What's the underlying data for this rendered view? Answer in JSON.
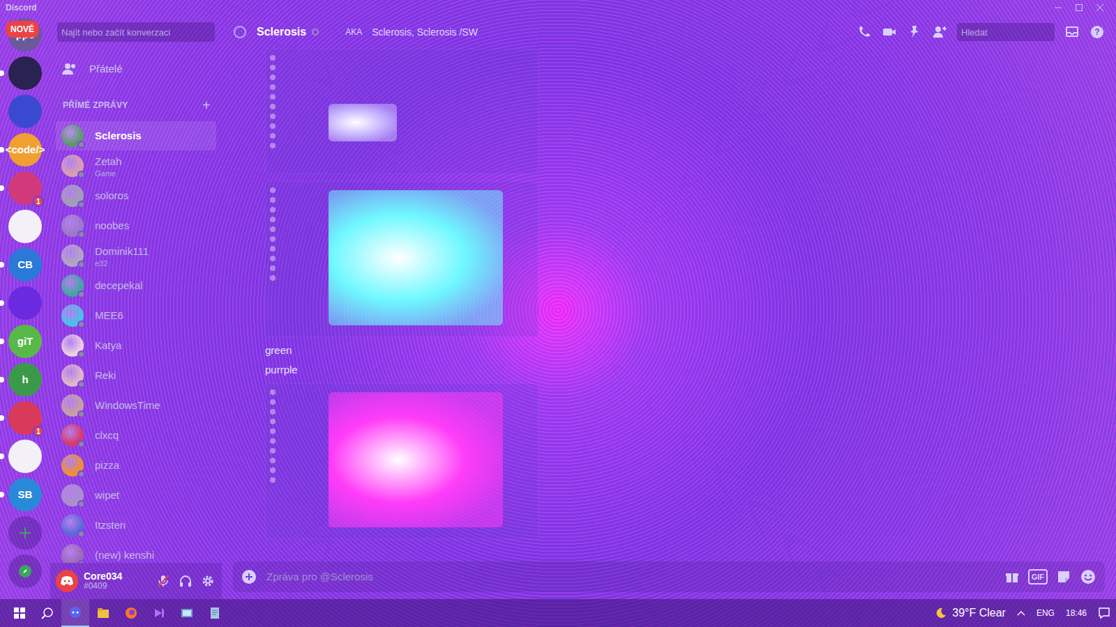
{
  "window": {
    "title": "Discord"
  },
  "servers": {
    "new_badge": "NOVÉ",
    "items": [
      {
        "label": "ppc",
        "badge": "",
        "unread": false,
        "color": "#6a5a9a"
      },
      {
        "label": "",
        "badge": "",
        "unread": true,
        "color": "#2a2250"
      },
      {
        "label": "",
        "badge": "",
        "unread": false,
        "color": "#3a4ad0"
      },
      {
        "label": "<code/>",
        "badge": "",
        "unread": true,
        "color": "#f0a030"
      },
      {
        "label": "",
        "badge": "1",
        "unread": true,
        "color": "#d03a7a"
      },
      {
        "label": "",
        "badge": "",
        "unread": false,
        "color": "#f4f0f8"
      },
      {
        "label": "CB",
        "badge": "",
        "unread": true,
        "color": "#2a78d8"
      },
      {
        "label": "",
        "badge": "",
        "unread": true,
        "color": "#6a2ae0"
      },
      {
        "label": "giT",
        "badge": "",
        "unread": true,
        "color": "#58b848"
      },
      {
        "label": "h",
        "badge": "",
        "unread": true,
        "color": "#3a9a4a"
      },
      {
        "label": "",
        "badge": "1",
        "unread": true,
        "color": "#d83a5a"
      },
      {
        "label": "",
        "badge": "",
        "unread": true,
        "color": "#f4f0f8"
      },
      {
        "label": "SB",
        "badge": "",
        "unread": true,
        "color": "#2a88d8"
      }
    ]
  },
  "dm": {
    "search": {
      "placeholder": "Najít nebo začít konverzaci"
    },
    "friends": "Přátelé",
    "section": "PŘÍMÉ ZPRÁVY",
    "add": "+",
    "items": [
      {
        "name": "Sclerosis",
        "sub": "",
        "selected": true,
        "color": "#5a9a6a"
      },
      {
        "name": "Zetah",
        "sub": "Game",
        "selected": false,
        "color": "#d8a0b0"
      },
      {
        "name": "soloros",
        "sub": "",
        "selected": false,
        "color": "#a0a0b0"
      },
      {
        "name": "noobes",
        "sub": "",
        "selected": false,
        "color": "#9a7ac8"
      },
      {
        "name": "Dominik111",
        "sub": "e32",
        "selected": false,
        "color": "#b0a8c0"
      },
      {
        "name": "decepekal",
        "sub": "",
        "selected": false,
        "color": "#40a8a0"
      },
      {
        "name": "MEE6",
        "sub": "",
        "selected": false,
        "color": "#4ac0e8"
      },
      {
        "name": "Katya",
        "sub": "",
        "selected": false,
        "color": "#e8d0e0"
      },
      {
        "name": "Reki",
        "sub": "",
        "selected": false,
        "color": "#e0b8c8"
      },
      {
        "name": "WindowsTime",
        "sub": "",
        "selected": false,
        "color": "#c8a0a0"
      },
      {
        "name": "clxcq",
        "sub": "",
        "selected": false,
        "color": "#d83a6a"
      },
      {
        "name": "pizza",
        "sub": "",
        "selected": false,
        "color": "#f09030"
      },
      {
        "name": "wipet",
        "sub": "",
        "selected": false,
        "color": "#a890c8"
      },
      {
        "name": "Itzsten",
        "sub": "",
        "selected": false,
        "color": "#5a6ad8"
      },
      {
        "name": "(new) kenshi",
        "sub": "",
        "selected": false,
        "color": "#9a6ab8"
      }
    ]
  },
  "user": {
    "name": "Core034",
    "tag": "#0409",
    "mic_muted": true
  },
  "chat": {
    "name": "Sclerosis",
    "aka": "AKA",
    "aka_names": "Sclerosis, Sclerosis /SW",
    "search": {
      "placeholder": "Hledat"
    },
    "messages": [
      {
        "kind": "image",
        "text": "",
        "color": "#c8b8ff"
      },
      {
        "kind": "image",
        "text": "",
        "color": "#6ff8ff"
      },
      {
        "kind": "text",
        "text": "green",
        "color": "#e8e2ff"
      },
      {
        "kind": "text",
        "text": "purrple",
        "color": "#e8e2ff"
      },
      {
        "kind": "image",
        "text": "",
        "color": "#ff3cf8"
      }
    ],
    "input": {
      "placeholder": "Zpráva pro @Sclerosis"
    },
    "gif": "GIF"
  },
  "taskbar": {
    "weather": "39°F Clear",
    "lang": "ENG",
    "time": "18:46",
    "apps": [
      {
        "selected": true
      },
      {
        "selected": false
      },
      {
        "selected": false
      },
      {
        "selected": false
      },
      {
        "selected": false
      },
      {
        "selected": false
      }
    ]
  }
}
